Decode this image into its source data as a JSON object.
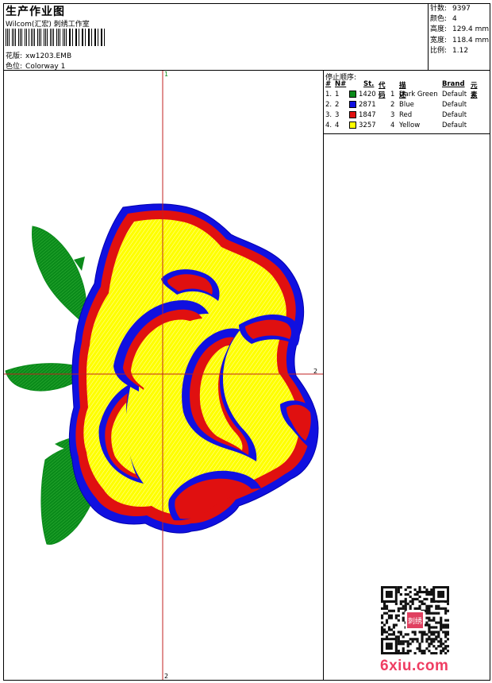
{
  "header": {
    "title": "生产作业图",
    "company": "Wilcom(汇宏) 刺绣工作室",
    "design_label": "花版:",
    "design_value": "xw1203.EMB",
    "colorway_label": "色位:",
    "colorway_value": "Colorway 1"
  },
  "stats": [
    {
      "label": "针数:",
      "value": "9397"
    },
    {
      "label": "颜色:",
      "value": "4"
    },
    {
      "label": "高度:",
      "value": "129.4 mm"
    },
    {
      "label": "宽度:",
      "value": "118.4 mm"
    },
    {
      "label": "比例:",
      "value": "1.12"
    }
  ],
  "color_table": {
    "title": "停止顺序:",
    "headers": [
      "#",
      "N#",
      "St.",
      "代码",
      "描述",
      "Brand",
      "元素"
    ],
    "rows": [
      {
        "num": "1.",
        "n": "1",
        "stitches": "1420",
        "code": "1",
        "desc": "Dark Green",
        "brand": "Default",
        "color": "#0a8a1a"
      },
      {
        "num": "2.",
        "n": "2",
        "stitches": "2871",
        "code": "2",
        "desc": "Blue",
        "brand": "Default",
        "color": "#1010e0"
      },
      {
        "num": "3.",
        "n": "3",
        "stitches": "1847",
        "code": "3",
        "desc": "Red",
        "brand": "Default",
        "color": "#e01010"
      },
      {
        "num": "4.",
        "n": "4",
        "stitches": "3257",
        "code": "4",
        "desc": "Yellow",
        "brand": "Default",
        "color": "#ffff00"
      }
    ]
  },
  "axes": {
    "v_top": "1",
    "v_bottom": "2",
    "h_right": "2"
  },
  "watermark": {
    "site": "6xiu.com",
    "seal_text": "刺绣"
  }
}
